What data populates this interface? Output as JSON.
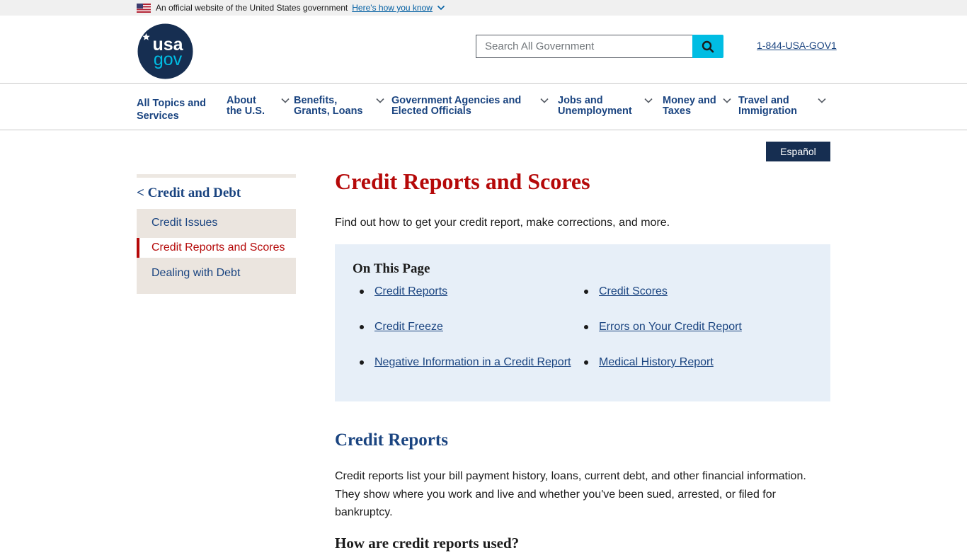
{
  "banner": {
    "text": "An official website of the United States government",
    "link": "Here's how you know"
  },
  "header": {
    "logo_top": "usa",
    "logo_bottom": "gov",
    "search": {
      "placeholder": "Search All Government"
    },
    "phone": "1-844-USA-GOV1"
  },
  "nav": {
    "items": [
      {
        "line1": "All Topics and",
        "line2": "Services",
        "has_menu": false
      },
      {
        "line1": "About",
        "line2": "the U.S.",
        "has_menu": true
      },
      {
        "line1": "Benefits,",
        "line2": "Grants, Loans",
        "has_menu": true
      },
      {
        "line1": "Government Agencies and",
        "line2": "Elected Officials",
        "has_menu": true
      },
      {
        "line1": "Jobs and",
        "line2": "Unemployment",
        "has_menu": true
      },
      {
        "line1": "Money and",
        "line2": "Taxes",
        "has_menu": true
      },
      {
        "line1": "Travel and",
        "line2": "Immigration",
        "has_menu": true
      }
    ]
  },
  "language_button": "Español",
  "sidebar": {
    "parent": "< Credit and Debt",
    "items": [
      {
        "label": "Credit Issues",
        "active": false
      },
      {
        "label": "Credit Reports and Scores",
        "active": true
      },
      {
        "label": "Dealing with Debt",
        "active": false
      }
    ]
  },
  "main": {
    "title": "Credit Reports and Scores",
    "intro": "Find out how to get your credit report, make corrections, and more.",
    "on_this_page": {
      "heading": "On This Page",
      "links": [
        "Credit Reports",
        "Credit Scores",
        "Credit Freeze",
        "Errors on Your Credit Report",
        "Negative Information in a Credit Report",
        "Medical History Report"
      ]
    },
    "section": {
      "heading": "Credit Reports",
      "paragraph": "Credit reports list your bill payment history, loans, current debt, and other financial information. They show where you work and live and whether you've been sued, arrested, or filed for bankruptcy.",
      "subheading": "How are credit reports used?"
    }
  },
  "colors": {
    "primary": "#1a4480",
    "title_red": "#b50909",
    "search_button": "#00bde3",
    "language_button": "#162e51",
    "otp_background": "#e7eff8",
    "sidebar_background": "#ebe5df"
  }
}
